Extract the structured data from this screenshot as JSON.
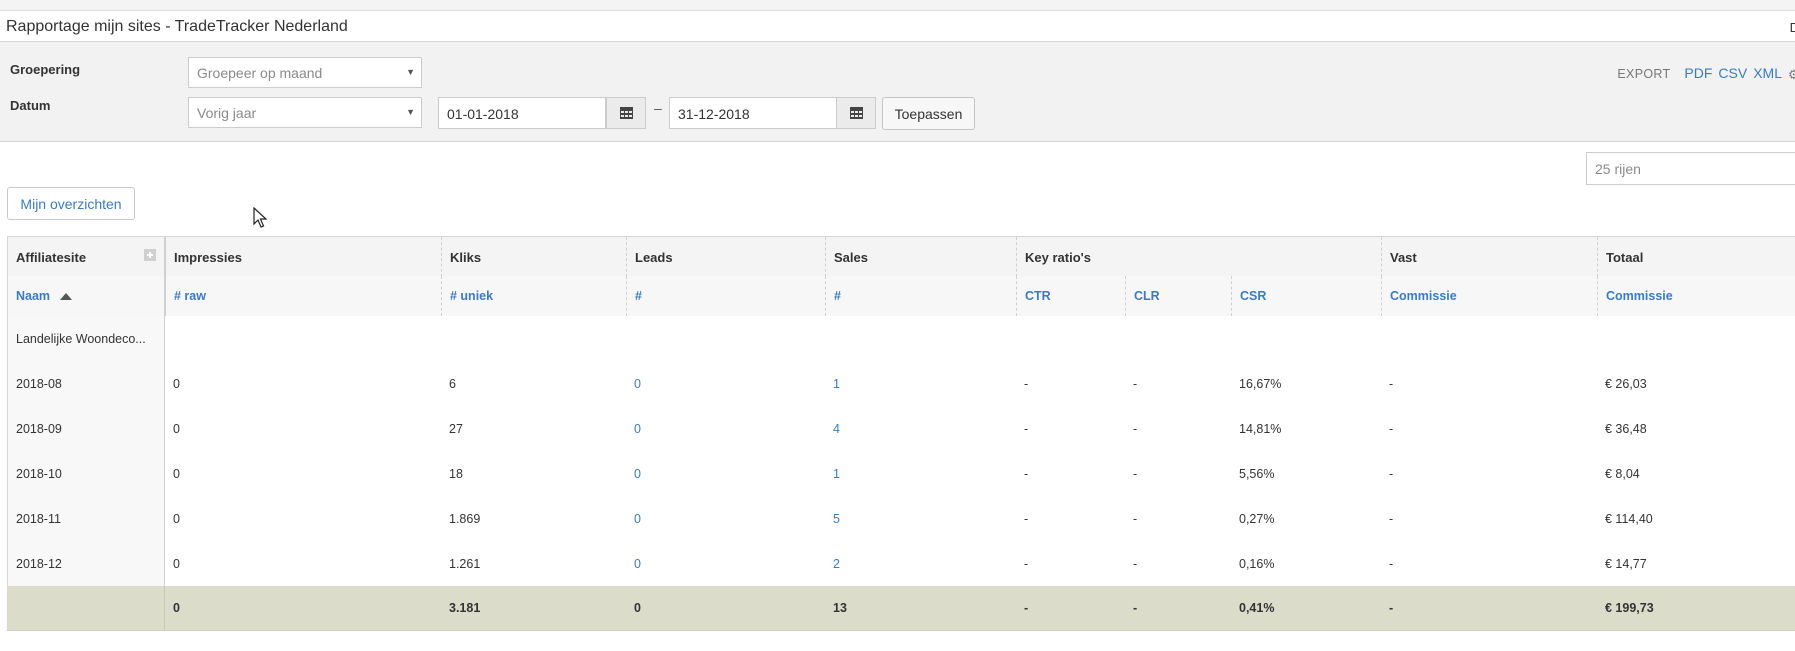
{
  "window": {
    "title": "Rapportage mijn sites - TradeTracker Nederland",
    "right_fragment": "D"
  },
  "filters": {
    "grouping_label": "Groepering",
    "grouping_value": "Groepeer op maand",
    "date_label": "Datum",
    "date_preset": "Vorig jaar",
    "date_from": "01-01-2018",
    "date_separator": "–",
    "date_to": "31-12-2018",
    "apply_label": "Toepassen"
  },
  "export": {
    "label": "EXPORT",
    "options": [
      "PDF",
      "CSV",
      "XML"
    ]
  },
  "rows_select": "25 rijen",
  "overviews_button": "Mijn overzichten",
  "table": {
    "group_headers": [
      "Affiliatesite",
      "Impressies",
      "Kliks",
      "Leads",
      "Sales",
      "Key ratio's",
      "Vast",
      "Totaal"
    ],
    "sub_headers": [
      "Naam",
      "# raw",
      "# uniek",
      "#",
      "#",
      "CTR",
      "CLR",
      "CSR",
      "Commissie",
      "Commissie"
    ],
    "site_name": "Landelijke Woondeco...",
    "rows": [
      [
        "2018-08",
        "0",
        "6",
        "0",
        "1",
        "-",
        "-",
        "16,67%",
        "-",
        "€ 26,03"
      ],
      [
        "2018-09",
        "0",
        "27",
        "0",
        "4",
        "-",
        "-",
        "14,81%",
        "-",
        "€ 36,48"
      ],
      [
        "2018-10",
        "0",
        "18",
        "0",
        "1",
        "-",
        "-",
        "5,56%",
        "-",
        "€ 8,04"
      ],
      [
        "2018-11",
        "0",
        "1.869",
        "0",
        "5",
        "-",
        "-",
        "0,27%",
        "-",
        "€ 114,40"
      ],
      [
        "2018-12",
        "0",
        "1.261",
        "0",
        "2",
        "-",
        "-",
        "0,16%",
        "-",
        "€ 14,77"
      ]
    ],
    "totals": [
      "",
      "0",
      "3.181",
      "0",
      "13",
      "-",
      "-",
      "0,41%",
      "-",
      "€ 199,73"
    ]
  },
  "colors": {
    "link": "#3b7bbf",
    "totals_bg": "#dcdcca",
    "filter_bg": "#f2f2f2"
  },
  "icons": [
    "calendar-icon",
    "caret-down-icon",
    "sort-asc-icon",
    "expand-plus-icon",
    "settings-icon",
    "mouse-cursor-icon"
  ]
}
